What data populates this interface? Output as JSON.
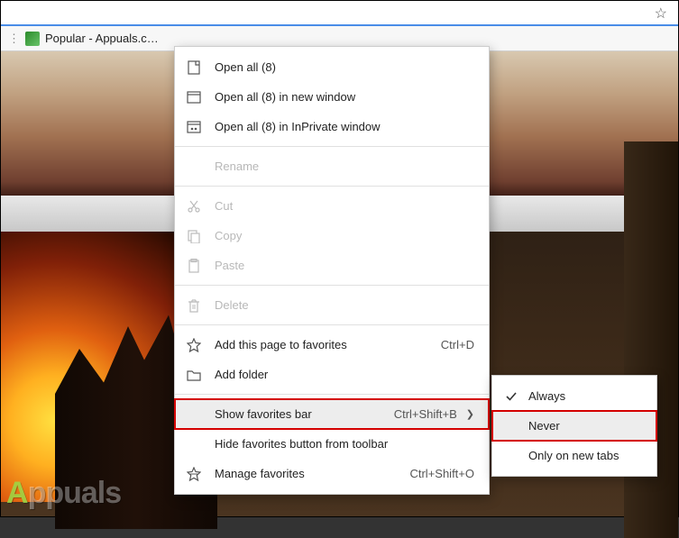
{
  "toolbar": {
    "fav_star": "☆"
  },
  "bookmarks": {
    "overflow_dots": "⋮",
    "item_label": "Popular - Appuals.c…"
  },
  "ctx": {
    "open_all": "Open all (8)",
    "open_all_new_window": "Open all (8) in new window",
    "open_all_inprivate": "Open all (8) in InPrivate window",
    "rename": "Rename",
    "cut": "Cut",
    "copy": "Copy",
    "paste": "Paste",
    "delete": "Delete",
    "add_page": "Add this page to favorites",
    "add_page_sc": "Ctrl+D",
    "add_folder": "Add folder",
    "show_fav_bar": "Show favorites bar",
    "show_fav_bar_sc": "Ctrl+Shift+B",
    "hide_fav_btn": "Hide favorites button from toolbar",
    "manage_fav": "Manage favorites",
    "manage_fav_sc": "Ctrl+Shift+O"
  },
  "submenu": {
    "always": "Always",
    "never": "Never",
    "only_new": "Only on new tabs"
  },
  "watermark": "ppuals"
}
